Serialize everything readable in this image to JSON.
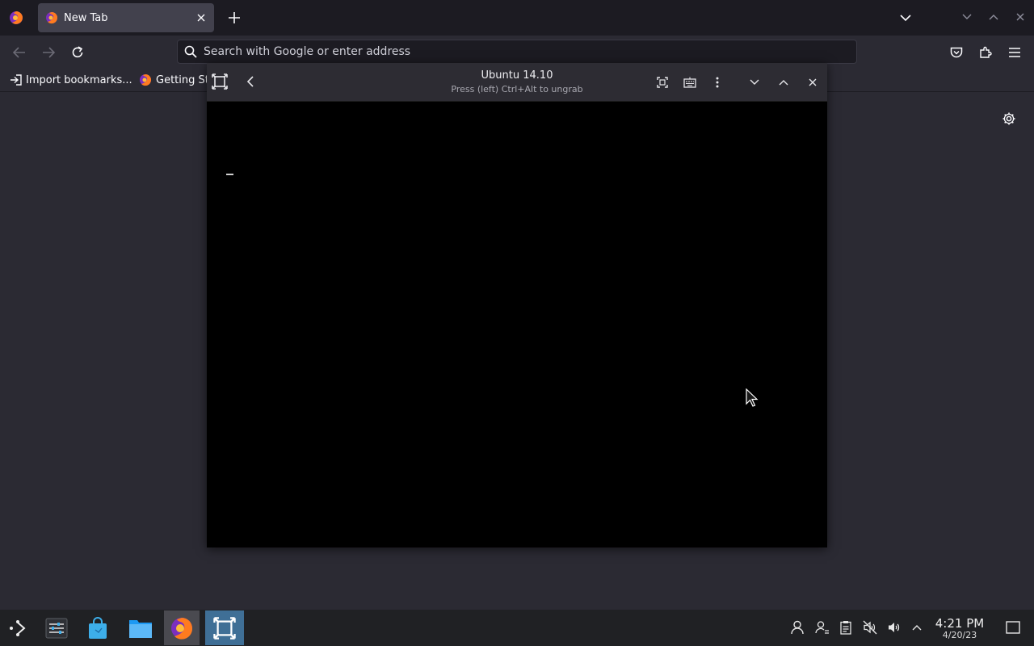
{
  "browser": {
    "tab": {
      "title": "New Tab"
    },
    "urlbar": {
      "placeholder": "Search with Google or enter address"
    },
    "bookmarks": [
      {
        "label": "Import bookmarks..."
      },
      {
        "label": "Getting St"
      }
    ]
  },
  "vm_window": {
    "title": "Ubuntu 14.10",
    "subtitle": "Press (left) Ctrl+Alt to ungrab"
  },
  "taskbar": {
    "clock": {
      "time": "4:21 PM",
      "date": "4/20/23"
    }
  },
  "colors": {
    "accent": "#3f6f96",
    "browser_bg": "#2b2a33",
    "tabstrip_bg": "#1c1b22",
    "vm_screen": "#000000"
  }
}
